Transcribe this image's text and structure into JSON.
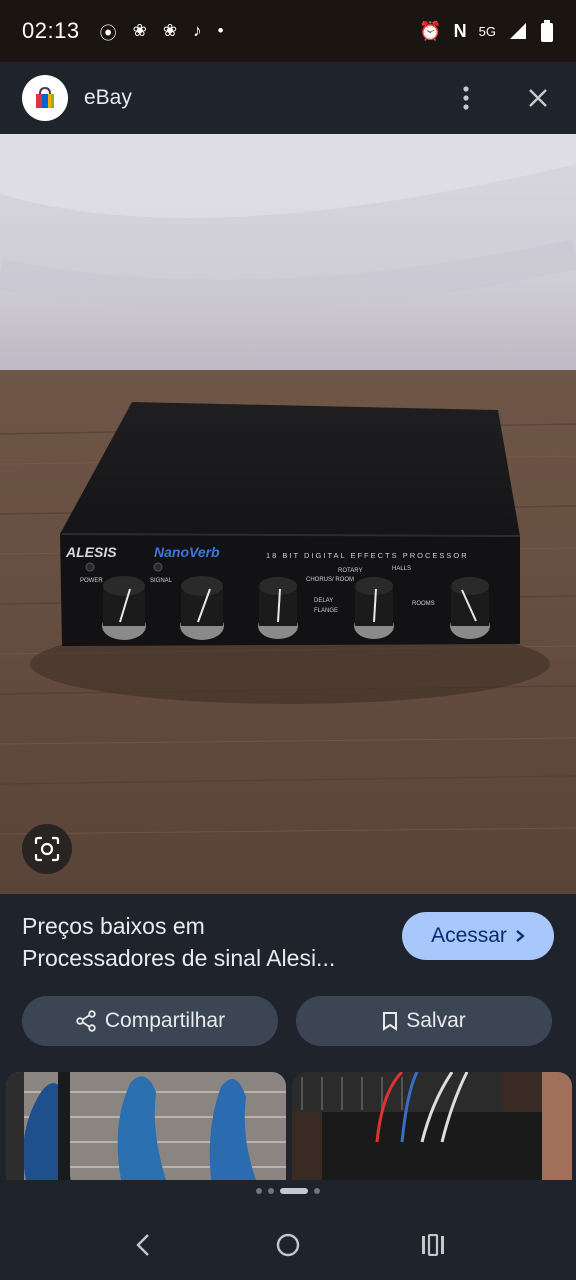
{
  "status_bar": {
    "time": "02:13",
    "left_icons": [
      "record-icon",
      "pinwheel-icon",
      "pinwheel-icon",
      "tiktok-icon",
      "dot-icon"
    ],
    "network": "5G"
  },
  "header": {
    "site_name": "eBay",
    "logo_icon": "ebay-shopping-bag-icon"
  },
  "result": {
    "title_line1": "Preços baixos em",
    "title_line2": "Processadores de sinal Alesi...",
    "visit_label": "Acessar",
    "share_label": "Compartilhar",
    "save_label": "Salvar"
  },
  "product_image": {
    "device_brand": "ALESIS",
    "device_model": "NanoVerb",
    "device_subtitle": "18 BIT DIGITAL EFFECTS PROCESSOR",
    "label_power": "POWER",
    "label_signal": "SIGNAL",
    "label_chorus_room": "CHORUS/ ROOM",
    "label_rotary": "ROTARY",
    "label_halls": "HALLS",
    "label_delay": "DELAY",
    "label_flange": "FLANGE",
    "label_rooms": "ROOMS"
  },
  "pager": {
    "count": 4,
    "active": 2
  },
  "colors": {
    "accent": "#a8c7fa",
    "button_bg": "#3b4554",
    "background": "#1f232b"
  }
}
